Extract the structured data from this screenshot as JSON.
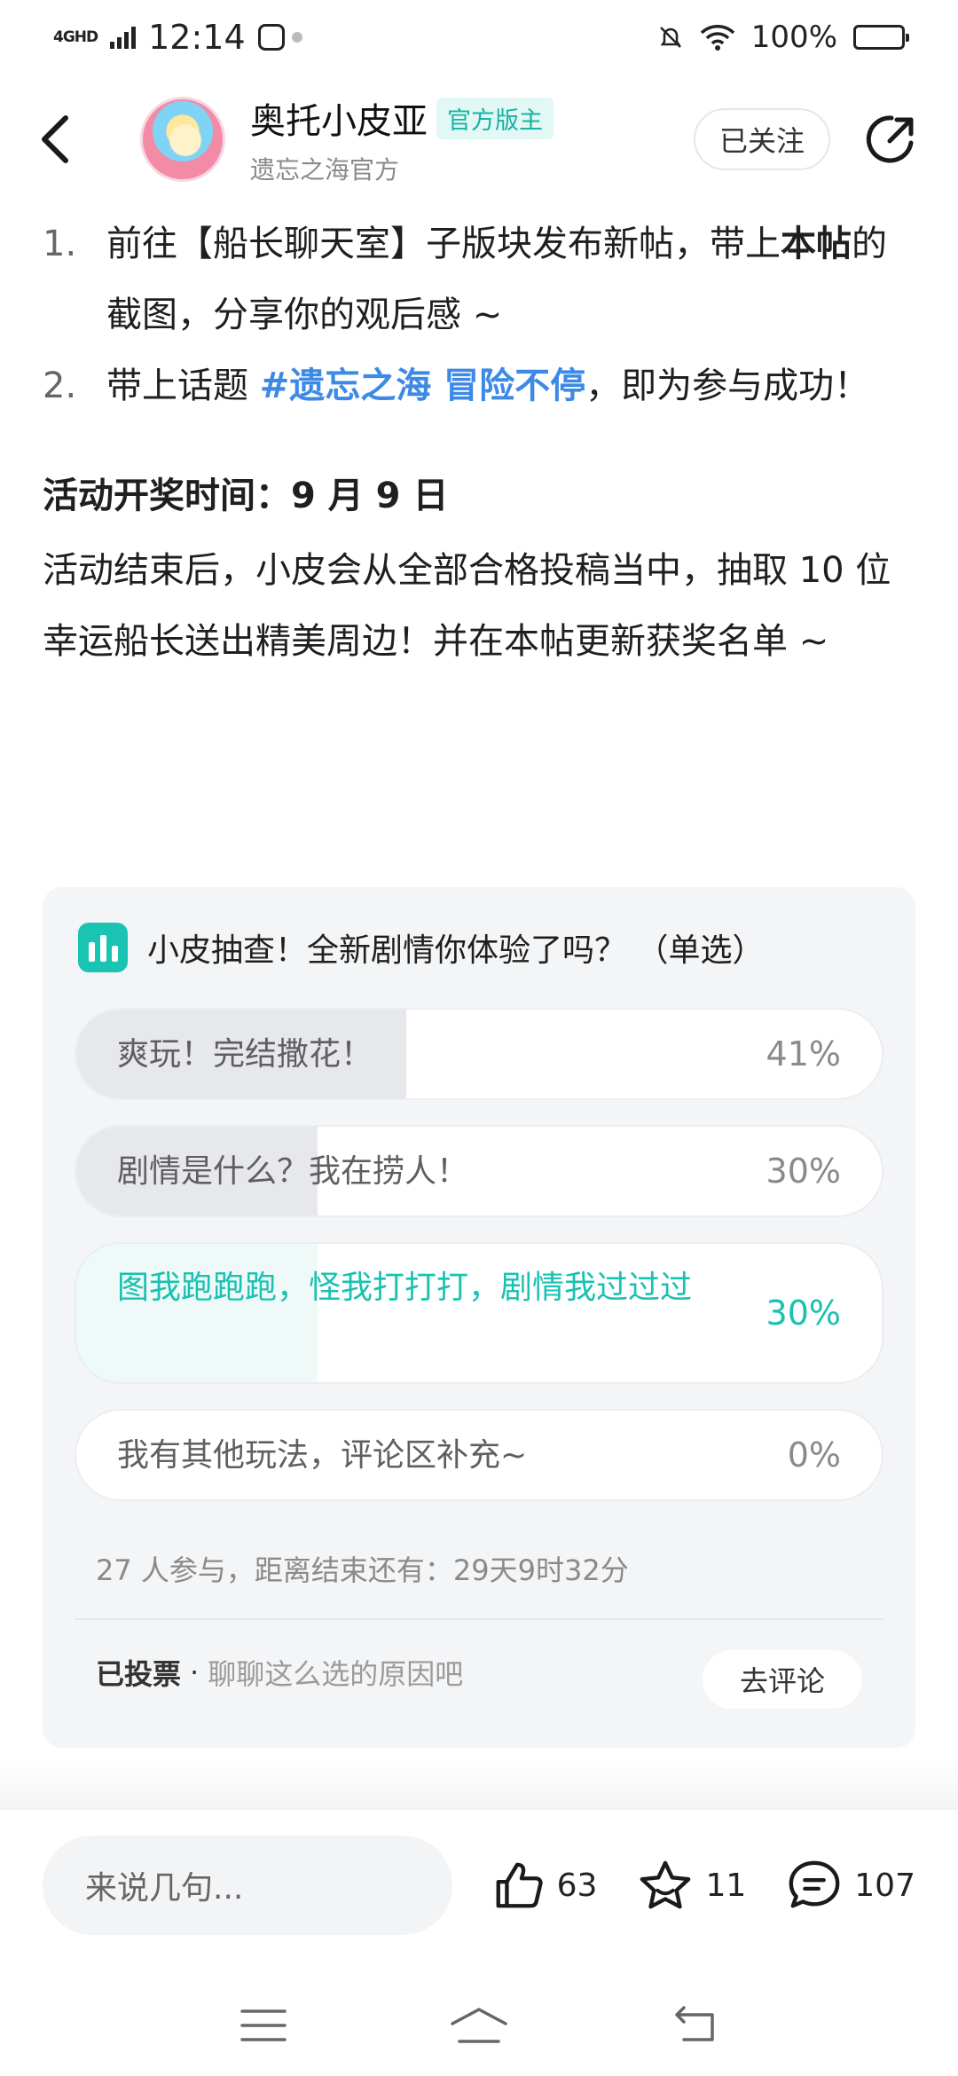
{
  "status_bar": {
    "network": "4GHD",
    "time": "12:14",
    "battery": "100%"
  },
  "header": {
    "author_name": "奥托小皮亚",
    "author_badge": "官方版主",
    "author_sub": "遗忘之海官方",
    "follow_label": "已关注"
  },
  "article": {
    "items": [
      {
        "num": "1.",
        "part1": "前往【船长聊天室】子版块发布新帖，带上",
        "bold": "本帖",
        "part2": "的截图，分享你的观后感 ~"
      },
      {
        "num": "2.",
        "part1": "带上话题 ",
        "topic": "#遗忘之海 冒险不停",
        "part2": "，即为参与成功！"
      }
    ],
    "section_title": "活动开奖时间：9 月 9 日",
    "paragraph": "活动结束后，小皮会从全部合格投稿当中，抽取 10 位幸运船长送出精美周边！并在本帖更新获奖名单 ~"
  },
  "poll": {
    "title": "小皮抽查！全新剧情你体验了吗？ （单选）",
    "options": [
      {
        "label": "爽玩！完结撒花！",
        "percent": "41%",
        "fill": 0.41,
        "selected": false
      },
      {
        "label": "剧情是什么？我在捞人！",
        "percent": "30%",
        "fill": 0.3,
        "selected": false
      },
      {
        "label": "图我跑跑跑，怪我打打打，剧情我过过过",
        "percent": "30%",
        "fill": 0.3,
        "selected": true
      },
      {
        "label": "我有其他玩法，评论区补充~",
        "percent": "0%",
        "fill": 0.0,
        "selected": false
      }
    ],
    "meta": "27 人参与，距离结束还有：29天9时32分",
    "voted": "已投票",
    "separator": "·",
    "reason_hint": "聊聊这么选的原因吧",
    "comment_button": "去评论"
  },
  "bottom_bar": {
    "input_placeholder": "来说几句...",
    "likes": "63",
    "favorites": "11",
    "comments": "107"
  },
  "colors": {
    "accent": "#18c1b0",
    "topic": "#3d8ae6",
    "card_bg": "#f4f5f7"
  }
}
